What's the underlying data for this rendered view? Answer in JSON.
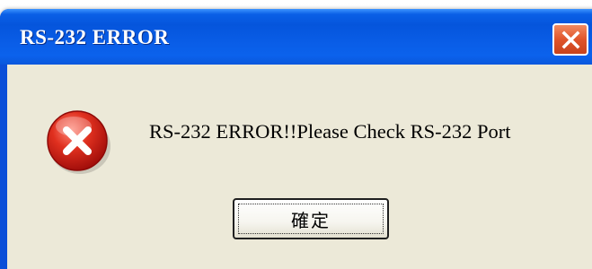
{
  "dialog": {
    "title": "RS-232 ERROR",
    "message": "RS-232 ERROR!!Please Check RS-232 Port",
    "ok_label": "確定"
  },
  "icons": {
    "close": "close-icon",
    "error": "error-icon"
  },
  "colors": {
    "titlebar": "#0555dc",
    "close_button": "#e0542a",
    "client_background": "#ece9d8",
    "error_red": "#d8261c"
  }
}
